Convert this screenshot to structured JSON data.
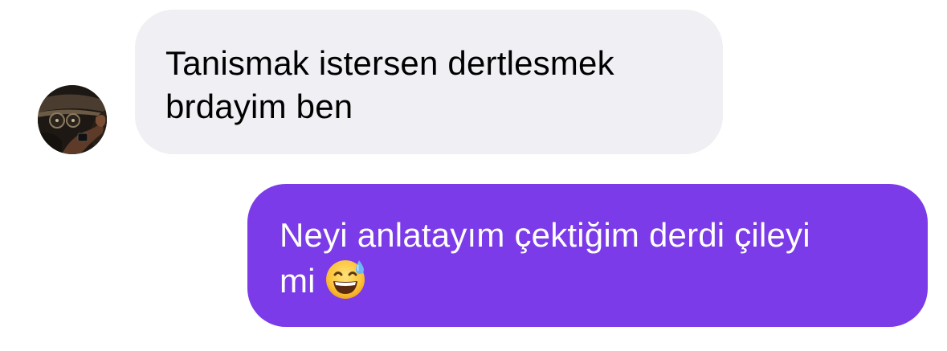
{
  "chat": {
    "incoming_message": {
      "lines": [
        "Tanismak istersen dertlesmek",
        "brdayim ben"
      ]
    },
    "outgoing_message": {
      "lines": [
        "Neyi anlatayım çektiğim derdi çileyi",
        "mi"
      ],
      "emoji": "grinning-face-with-sweat-icon"
    },
    "sender_avatar": "car-dashboard-photo-avatar"
  },
  "colors": {
    "incoming_bubble": "#efeff4",
    "outgoing_bubble": "#7b3be8",
    "incoming_text": "#000000",
    "outgoing_text": "#ffffff"
  }
}
